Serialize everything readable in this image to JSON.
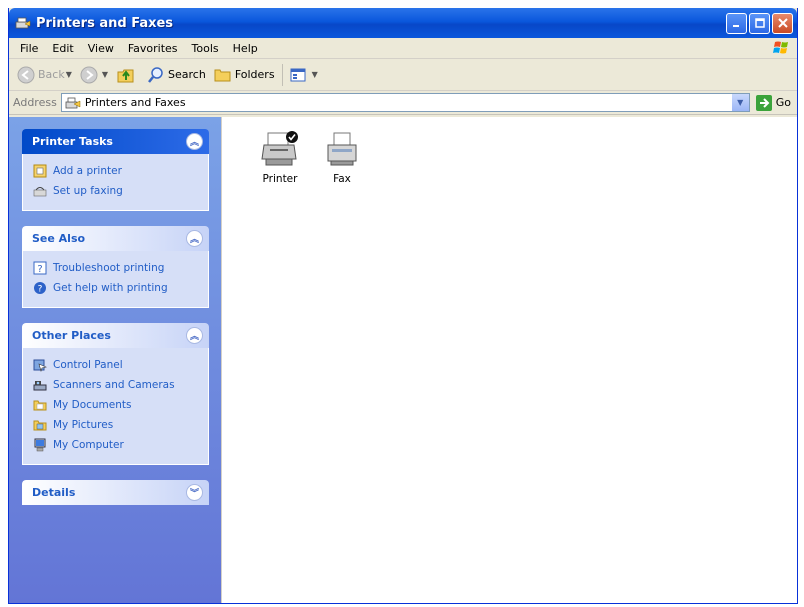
{
  "window": {
    "title": "Printers and Faxes"
  },
  "menu": [
    "File",
    "Edit",
    "View",
    "Favorites",
    "Tools",
    "Help"
  ],
  "toolbar": {
    "back_label": "Back",
    "search_label": "Search",
    "folders_label": "Folders"
  },
  "address": {
    "label": "Address",
    "value": "Printers and Faxes",
    "go_label": "Go"
  },
  "taskpane": {
    "printer_tasks": {
      "title": "Printer Tasks",
      "items": [
        "Add a printer",
        "Set up faxing"
      ]
    },
    "see_also": {
      "title": "See Also",
      "items": [
        "Troubleshoot printing",
        "Get help with printing"
      ]
    },
    "other_places": {
      "title": "Other Places",
      "items": [
        "Control Panel",
        "Scanners and Cameras",
        "My Documents",
        "My Pictures",
        "My Computer"
      ]
    },
    "details": {
      "title": "Details"
    }
  },
  "files": [
    {
      "label": "Printer",
      "icon": "printer-default-icon"
    },
    {
      "label": "Fax",
      "icon": "fax-icon"
    }
  ],
  "colors": {
    "titlebar": "#0a57dc",
    "taskpane_top": "#7ba2e7",
    "taskpane_bottom": "#6375d6",
    "link": "#215dc6"
  }
}
